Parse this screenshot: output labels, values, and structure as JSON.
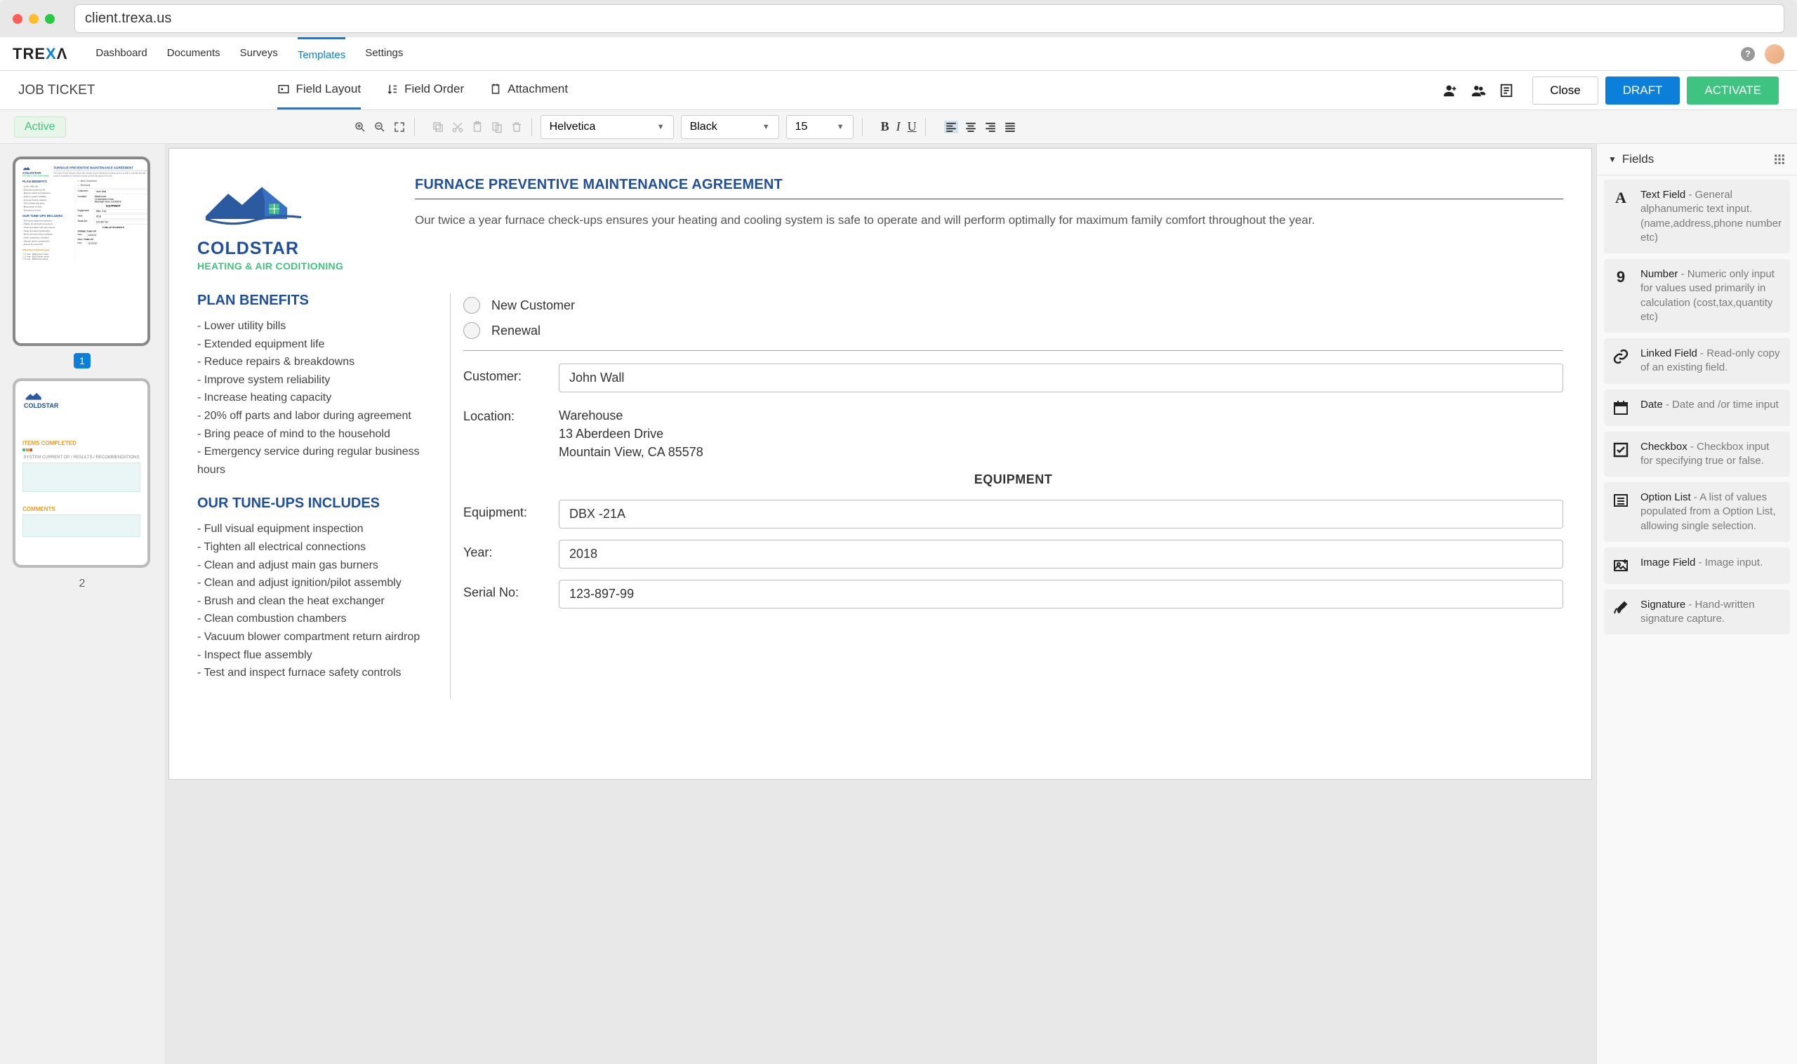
{
  "browser": {
    "url": "client.trexa.us"
  },
  "brand": {
    "name_pre": "TRE",
    "name_x": "X",
    "name_post": "Λ"
  },
  "nav": {
    "links": [
      "Dashboard",
      "Documents",
      "Surveys",
      "Templates",
      "Settings"
    ],
    "active_index": 3
  },
  "sub_nav": {
    "title": "JOB TICKET",
    "tabs": [
      {
        "label": "Field Layout"
      },
      {
        "label": "Field Order"
      },
      {
        "label": "Attachment"
      }
    ],
    "active_index": 0,
    "close_label": "Close",
    "draft_label": "DRAFT",
    "activate_label": "ACTIVATE"
  },
  "toolbar": {
    "status_badge": "Active",
    "font": "Helvetica",
    "color": "Black",
    "size": "15"
  },
  "thumbnails": {
    "pages": [
      "1",
      "2"
    ],
    "active_index": 0
  },
  "document": {
    "logo": {
      "name": "COLDSTAR",
      "sub": "HEATING & AIR CODITIONING"
    },
    "title": "FURNACE PREVENTIVE MAINTENANCE AGREEMENT",
    "intro": "Our twice a year furnace check-ups ensures your heating and cooling system is safe to operate and will perform optimally for maximum family comfort throughout the year.",
    "plan_benefits_heading": "PLAN BENEFITS",
    "plan_benefits": [
      "Lower utility bills",
      "Extended equipment life",
      "Reduce repairs & breakdowns",
      "Improve system reliability",
      "Increase heating capacity",
      "20% off parts and labor during agreement",
      "Bring peace of mind to the household",
      "Emergency service during regular business hours"
    ],
    "tuneups_heading": "OUR TUNE-UPS INCLUDES",
    "tuneups": [
      "Full visual equipment inspection",
      "Tighten all electrical connections",
      "Clean and adjust main gas burners",
      "Clean and adjust ignition/pilot assembly",
      "Brush and clean the heat exchanger",
      "Clean combustion chambers",
      "Vacuum blower compartment return airdrop",
      "Inspect flue assembly",
      "Test and inspect furnace safety controls"
    ],
    "radio_new": "New Customer",
    "radio_renewal": "Renewal",
    "customer_label": "Customer:",
    "customer_value": "John Wall",
    "location_label": "Location:",
    "location_lines": [
      "Warehouse",
      "13 Aberdeen Drive",
      "Mountain View, CA 85578"
    ],
    "equipment_heading": "EQUIPMENT",
    "equipment_label": "Equipment:",
    "equipment_value": "DBX -21A",
    "year_label": "Year:",
    "year_value": "2018",
    "serial_label": "Serial No:",
    "serial_value": "123-897-99"
  },
  "fields_panel": {
    "heading": "Fields",
    "items": [
      {
        "icon": "A",
        "name": "Text Field",
        "desc": " - General alphanumeric text input.(name,address,phone number etc)"
      },
      {
        "icon": "9",
        "name": "Number",
        "desc": " - Numeric only input for values used primarily in calculation (cost,tax,quantity etc)"
      },
      {
        "icon": "link",
        "name": "Linked Field",
        "desc": " - Read-only copy of an existing field."
      },
      {
        "icon": "date",
        "name": "Date",
        "desc": " - Date and /or time input"
      },
      {
        "icon": "check",
        "name": "Checkbox",
        "desc": " - Checkbox input for specifying true or false."
      },
      {
        "icon": "list",
        "name": "Option List",
        "desc": " - A list of values populated from a Option List, allowing single selection."
      },
      {
        "icon": "image",
        "name": "Image Field",
        "desc": " - Image input."
      },
      {
        "icon": "sig",
        "name": "Signature",
        "desc": " - Hand-written signature capture."
      }
    ]
  }
}
